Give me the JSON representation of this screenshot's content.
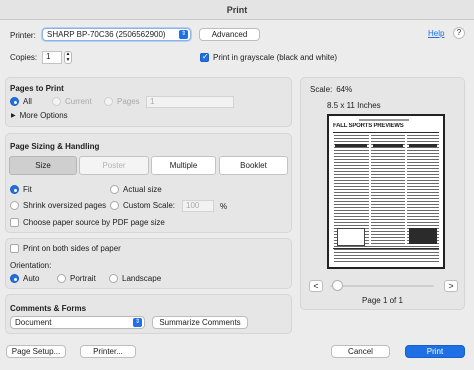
{
  "window": {
    "title": "Print"
  },
  "header": {
    "printer_label": "Printer:",
    "printer_value": "SHARP BP-70C36 (2506562900)",
    "advanced_label": "Advanced",
    "help_label": "Help",
    "copies_label": "Copies:",
    "copies_value": "1",
    "grayscale_label": "Print in grayscale (black and white)",
    "grayscale_checked": true
  },
  "pages": {
    "title": "Pages to Print",
    "all_label": "All",
    "current_label": "Current",
    "pages_label": "Pages",
    "pages_value": "1",
    "more_options_label": "More Options"
  },
  "sizing": {
    "title": "Page Sizing & Handling",
    "tabs": [
      {
        "label": "Size",
        "state": "selected"
      },
      {
        "label": "Poster",
        "state": "disabled"
      },
      {
        "label": "Multiple",
        "state": "normal"
      },
      {
        "label": "Booklet",
        "state": "normal"
      }
    ],
    "fit_label": "Fit",
    "actual_size_label": "Actual size",
    "shrink_label": "Shrink oversized pages",
    "custom_scale_label": "Custom Scale:",
    "custom_scale_value": "100",
    "percent_label": "%",
    "paper_source_label": "Choose paper source by PDF page size"
  },
  "orientation": {
    "both_sides_label": "Print on both sides of paper",
    "title": "Orientation:",
    "auto_label": "Auto",
    "portrait_label": "Portrait",
    "landscape_label": "Landscape"
  },
  "comments": {
    "title": "Comments & Forms",
    "select_value": "Document",
    "summarize_label": "Summarize Comments"
  },
  "preview": {
    "scale_label": "Scale:",
    "scale_value": "64%",
    "paper_size": "8.5 x 11 Inches",
    "doc_headline": "FALL SPORTS PREVIEWS",
    "prev_label": "<",
    "next_label": ">",
    "page_info": "Page 1 of 1"
  },
  "footer": {
    "page_setup_label": "Page Setup...",
    "printer_label": "Printer...",
    "cancel_label": "Cancel",
    "print_label": "Print"
  },
  "colors": {
    "accent": "#1f6fe5",
    "panel": "#e6e6e6"
  }
}
